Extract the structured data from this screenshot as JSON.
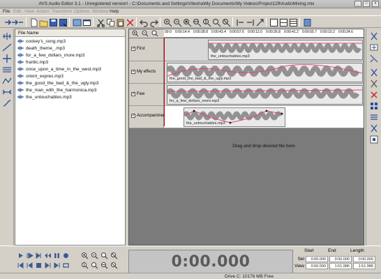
{
  "app": {
    "title": "AVS Audio Editor 3.1 - Unregistered version! - C:\\Documents and Settings\\Vilesha\\My Documents\\My Videos\\Project129\\AudioMixing.mix",
    "win_min": "_",
    "win_max": "□",
    "win_close": "x"
  },
  "menu": [
    {
      "label": "File"
    },
    {
      "label": "Edit"
    },
    {
      "label": "View"
    },
    {
      "label": "Action"
    },
    {
      "label": "Transform"
    },
    {
      "label": "Options"
    },
    {
      "label": "Window"
    },
    {
      "label": "Help"
    }
  ],
  "files": {
    "header": "File Name",
    "items": [
      "cockey’s_song.mp3",
      "death_theme_.mp3",
      "for_a_few_dollars_more.mp3",
      "frantic.mp3",
      "once_upon_a_time_in_the_west.mp3",
      "orient_expres.mp3",
      "the_good_the_bad_&_the_ugly.mp3",
      "the_man_with_the_harmonica.mp3",
      "the_untouchables.mp3"
    ]
  },
  "ruler": {
    "ticks": [
      "00:0",
      "0:00:14.4",
      "0:00:28.8",
      "0:00:43.4",
      "0:00:57.6",
      "0:00:12.0",
      "0:00:26.8",
      "0:00:41.2",
      "0:00:55.7",
      "0:00:10.2",
      "0:00:24.6"
    ]
  },
  "tracks": [
    {
      "name": "First",
      "check": "✓",
      "clip": "the_untouchables.mp3",
      "color": "#4a4a4a"
    },
    {
      "name": "My effects",
      "check": "✓",
      "clip": "the_good_the_bad_&_the_ugly.mp3",
      "color": "#4a4a4a"
    },
    {
      "name": "Few",
      "check": "✓",
      "clip": "for_a_few_dollars_more.mp3",
      "color": "#4a4a4a"
    },
    {
      "name": "Accompaniment",
      "check": "✓",
      "clip": "the_untouchables.mp3",
      "color": "#4a4a4a"
    }
  ],
  "dropzone": {
    "message": "Drag and drop desired file here"
  },
  "colors": {
    "envelope": "#e0476e",
    "cursor": "#cc0000",
    "waveform": "#4a4a4a"
  },
  "transport": {
    "time": "0:00.000"
  },
  "selview": {
    "headers": [
      "Start",
      "End",
      "Length"
    ],
    "rows": [
      {
        "label": "Sel",
        "start": "0:00.000",
        "end": "0:00.000",
        "length": "0:00.000"
      },
      {
        "label": "View",
        "start": "0:00.000",
        "end": "1:51.986",
        "length": "1:51.986"
      }
    ]
  },
  "status": {
    "drive": "Drive C: 10176 MB Free"
  }
}
